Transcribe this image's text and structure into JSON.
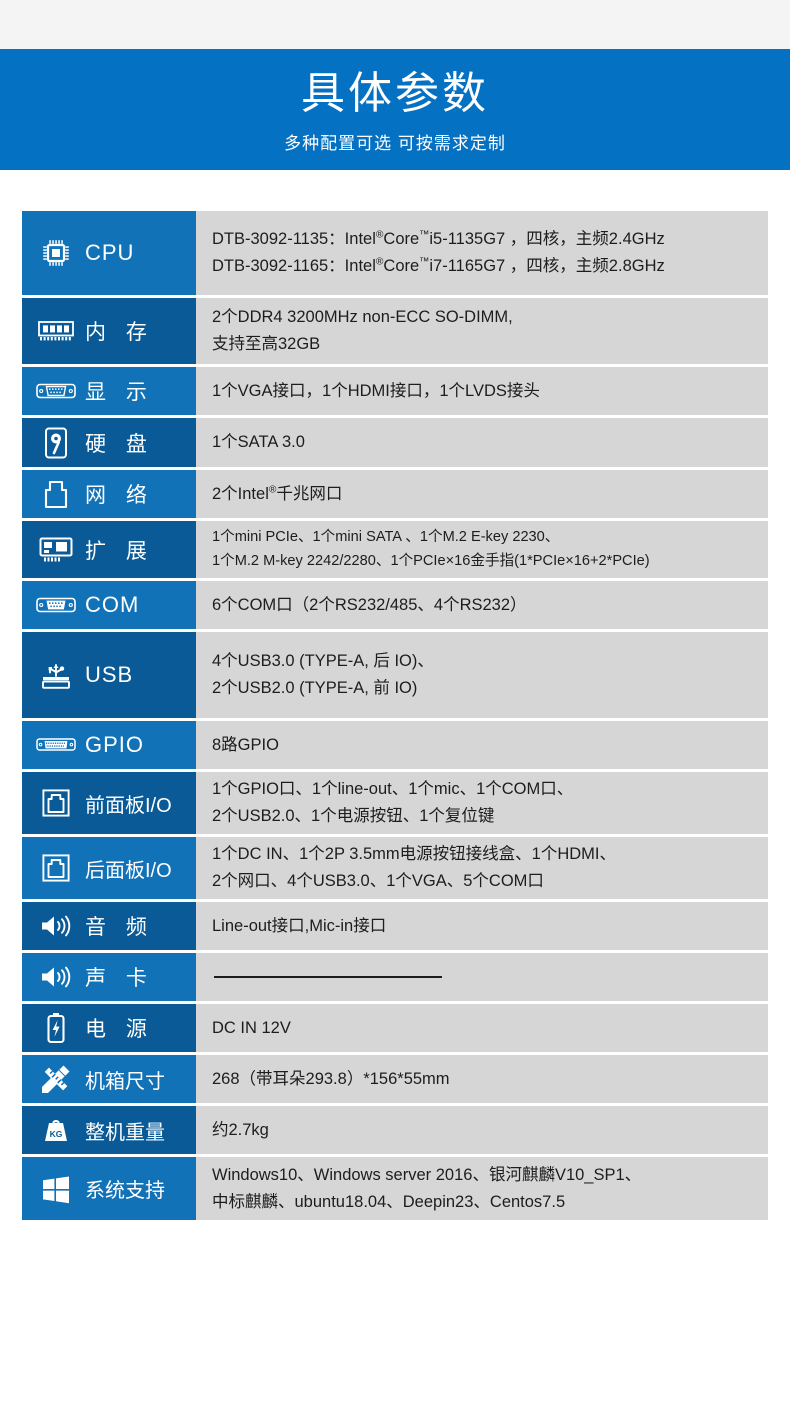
{
  "banner": {
    "title": "具体参数",
    "subtitle": "多种配置可选 可按需求定制"
  },
  "spec_rows": [
    {
      "icon": "cpu-chip-icon",
      "label": "CPU",
      "lines": [
        "DTB-3092-1135：Intel®Core™i5-1135G7 ，四核，主频2.4GHz",
        "DTB-3092-1165：Intel®Core™i7-1165G7 ，四核，主频2.8GHz"
      ]
    },
    {
      "icon": "memory-module-icon",
      "label": "内 存",
      "lines": [
        "2个DDR4 3200MHz non-ECC SO-DIMM,",
        "支持至高32GB"
      ]
    },
    {
      "icon": "vga-port-icon",
      "label": "显 示",
      "lines": [
        "1个VGA接口，1个HDMI接口，1个LVDS接头"
      ]
    },
    {
      "icon": "hard-disk-icon",
      "label": "硬 盘",
      "lines": [
        "1个SATA 3.0"
      ]
    },
    {
      "icon": "network-port-icon",
      "label": "网 络",
      "lines": [
        "2个Intel®千兆网口"
      ]
    },
    {
      "icon": "expansion-card-icon",
      "label": "扩 展",
      "lines": [
        "1个mini PCIe、1个mini SATA 、1个M.2 E-key 2230、",
        "1个M.2 M-key 2242/2280、1个PCIe×16金手指(1*PCIe×16+2*PCIe)"
      ]
    },
    {
      "icon": "com-port-icon",
      "label": "COM",
      "lines": [
        "6个COM口（2个RS232/485、4个RS232）"
      ]
    },
    {
      "icon": "usb-port-icon",
      "label": "USB",
      "lines": [
        "4个USB3.0 (TYPE-A, 后 IO)、",
        "2个USB2.0 (TYPE-A, 前 IO)"
      ]
    },
    {
      "icon": "gpio-connector-icon",
      "label": "GPIO",
      "lines": [
        "8路GPIO"
      ]
    },
    {
      "icon": "front-panel-icon",
      "label": "前面板I/O",
      "lines": [
        "1个GPIO口、1个line-out、1个mic、1个COM口、",
        "2个USB2.0、1个电源按钮、1个复位键"
      ]
    },
    {
      "icon": "rear-panel-icon",
      "label": "后面板I/O",
      "lines": [
        "1个DC IN、1个2P 3.5mm电源按钮接线盒、1个HDMI、",
        "2个网口、4个USB3.0、1个VGA、5个COM口"
      ]
    },
    {
      "icon": "speaker-icon",
      "label": "音 频",
      "lines": [
        "Line-out接口,Mic-in接口"
      ]
    },
    {
      "icon": "speaker-icon",
      "label": "声 卡",
      "lines": [
        "—"
      ]
    },
    {
      "icon": "battery-icon",
      "label": "电 源",
      "lines": [
        "DC IN 12V"
      ]
    },
    {
      "icon": "ruler-pencil-icon",
      "label": "机箱尺寸",
      "lines": [
        "268（带耳朵293.8）*156*55mm"
      ]
    },
    {
      "icon": "weight-icon",
      "label": "整机重量",
      "lines": [
        "约2.7kg"
      ]
    },
    {
      "icon": "windows-logo-icon",
      "label": "系统支持",
      "lines": [
        "Windows10、Windows server 2016、银河麒麟V10_SP1、",
        "中标麒麟、ubuntu18.04、Deepin23、Centos7.5"
      ]
    }
  ],
  "colors": {
    "banner_blue": "#0571c2",
    "label_light_blue": "#1272b8",
    "label_dark_blue": "#095a96",
    "value_grey": "#d6d6d6",
    "top_strip_grey": "#f4f4f4"
  }
}
